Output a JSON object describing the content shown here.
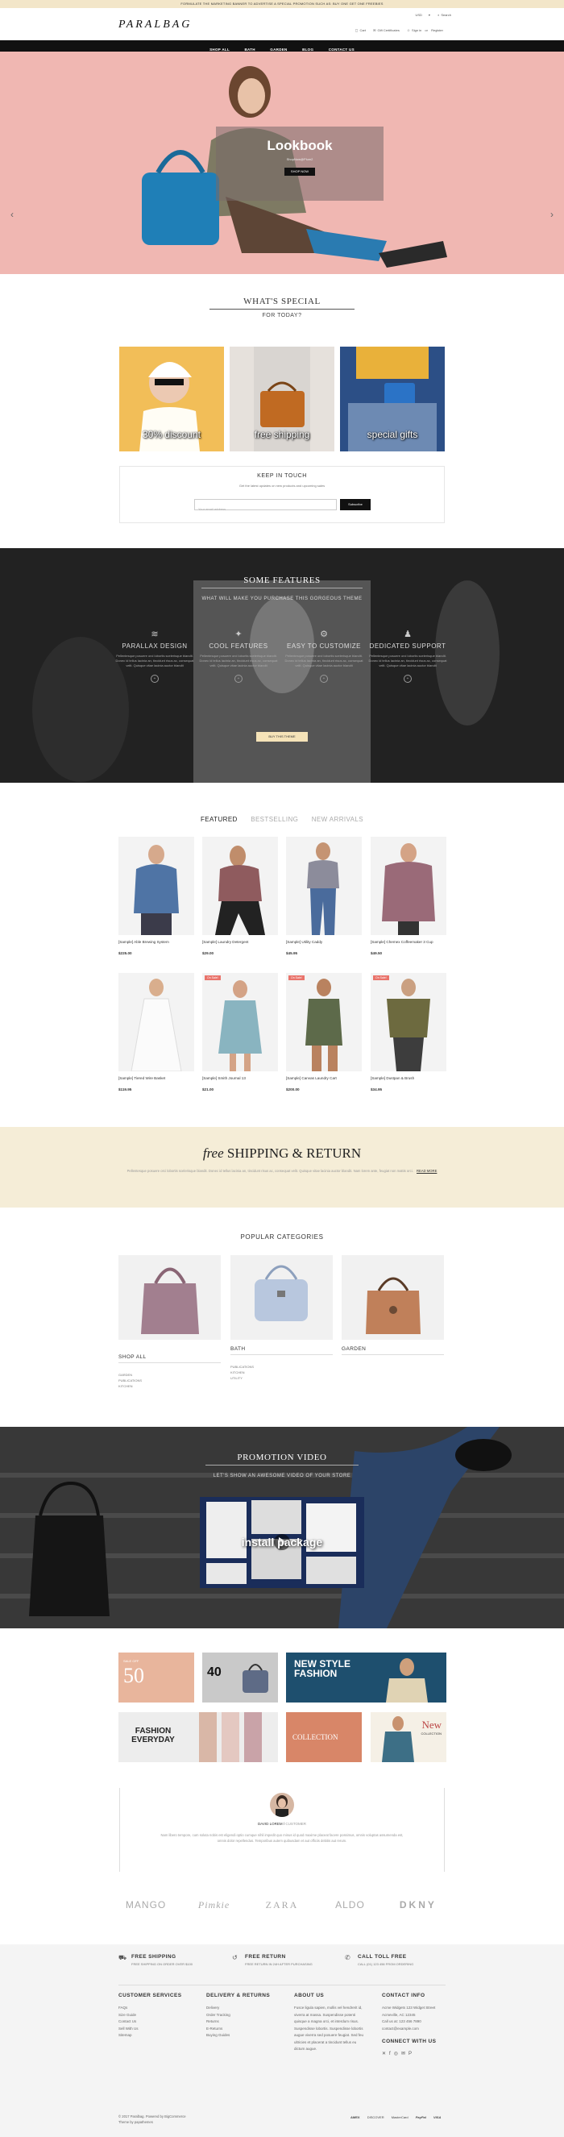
{
  "topbar": {
    "text": "FORMULATE THE MARKETING BANNER TO ADVERTISE A SPECIAL PROMOTION SUCH AS: BUY ONE GET ONE FREEBIES"
  },
  "header": {
    "logo": "PARALBAG",
    "currency": "USD",
    "search": "Search",
    "cart": "Cart",
    "gift": "Gift Certificates",
    "signin": "Sign in",
    "or": "or",
    "register": "Register"
  },
  "nav": {
    "items": [
      "SHOP ALL",
      "BATH",
      "GARDEN",
      "BLOG",
      "CONTACT US"
    ]
  },
  "hero": {
    "title": "Lookbook",
    "subtitle": "ShopNow@Plum2",
    "button": "SHOP NOW"
  },
  "special": {
    "title": "WHAT'S SPECIAL",
    "subtitle": "FOR TODAY?",
    "tiles": [
      "30% discount",
      "free shipping",
      "special gifts"
    ]
  },
  "newsletter": {
    "title": "KEEP IN TOUCH",
    "desc": "Get the latest updates on new products and upcoming sales",
    "placeholder": "Your email address",
    "button": "Subscribe"
  },
  "features": {
    "title": "SOME FEATURES",
    "subtitle": "WHAT WILL MAKE YOU PURCHASE THIS GORGEOUS THEME",
    "button": "BUY THIS THEME",
    "items": [
      {
        "title": "PARALLAX DESIGN",
        "text": "Pellentesque posuere orci lobortis scelerisque blandit. Donec id tellus lacinia an, tincidunt risus ac, consequat velit. Quisque vitae lacinia auctor blandit"
      },
      {
        "title": "COOL FEATURES",
        "text": "Pellentesque posuere orci lobortis scelerisque blandit. Donec id tellus lacinia an, tincidunt risus ac, consequat velit. Quisque vitae lacinia auctor blandit"
      },
      {
        "title": "EASY TO CUSTOMIZE",
        "text": "Pellentesque posuere orci lobortis scelerisque blandit. Donec id tellus lacinia an, tincidunt risus ac, consequat velit. Quisque vitae lacinia auctor blandit"
      },
      {
        "title": "DEDICATED SUPPORT",
        "text": "Pellentesque posuere orci lobortis scelerisque blandit. Donec id tellus lacinia an, tincidunt risus ac, consequat velit. Quisque vitae lacinia auctor blandit"
      }
    ]
  },
  "tabs": [
    "FEATURED",
    "BESTSELLING",
    "NEW ARRIVALS"
  ],
  "products": [
    {
      "name": "[Sample] Able Brewing System",
      "price": "$225.00",
      "badge": ""
    },
    {
      "name": "[Sample] Laundry Detergent",
      "price": "$29.00",
      "badge": ""
    },
    {
      "name": "[Sample] Utility Caddy",
      "price": "$45.95",
      "badge": ""
    },
    {
      "name": "[Sample] Chemex Coffeemaker 3 Cup",
      "price": "$49.50",
      "badge": ""
    },
    {
      "name": "[Sample] Tiered Wire Basket",
      "price": "$119.95",
      "badge": ""
    },
    {
      "name": "[Sample] Smith Journal 13",
      "price": "$21.00",
      "badge": "On Sale!"
    },
    {
      "name": "[Sample] Canvas Laundry Cart",
      "price": "$200.00",
      "badge": "On Sale!"
    },
    {
      "name": "[Sample] Dustpan & Brush",
      "price": "$34.95",
      "badge": "On Sale!"
    }
  ],
  "freeship": {
    "free": "free",
    "title": "SHIPPING & RETURN",
    "text": "Pellentesque posuere orci lobortis scelerisque blandit. Donec id tellus lacinia an, tincidunt risus ac, consequat velit. Quisque vitae lacinia auctor blandit. Nam lorem ante, feugiat non mattis orci.",
    "readmore": "READ MORE"
  },
  "categories": {
    "title": "POPULAR CATEGORIES",
    "items": [
      {
        "name": "SHOP ALL",
        "subs": [
          "GARDEN",
          "PUBLICATIONS",
          "KITCHEN"
        ]
      },
      {
        "name": "BATH",
        "subs": [
          "PUBLICATIONS",
          "KITCHEN",
          "UTILITY"
        ]
      },
      {
        "name": "GARDEN",
        "subs": []
      }
    ]
  },
  "promo": {
    "title": "PROMOTION VIDEO",
    "subtitle": "LET'S SHOW AN AWESOME VIDEO OF YOUR STORE",
    "video_text": "install package"
  },
  "banners": {
    "b1": "50",
    "b1small": "SALE OFF",
    "b2": "40",
    "b3": "NEW STYLE FASHION",
    "b4": "FASHION EVERYDAY",
    "b5": "COLLECTION",
    "b6": "New",
    "b6sub": "COLLECTION"
  },
  "testimonial": {
    "name": "DAVID LOREM",
    "role": "CUSTOMER",
    "text": "Nam libero tempore, cum soluta nobis est eligendi optio cumque nihil impedit quo minus id quod maxime placeat facere possimus, omnis voluptas assumenda est, omnis dolor repellendus. Temporibus autem quibusdam et aut officiis debitis aut rerum."
  },
  "brands": [
    "MANGO",
    "Pimkie",
    "ZARA",
    "ALDO",
    "DKNY"
  ],
  "services": [
    {
      "title": "FREE SHIPPING",
      "text": "FREE SHIPPING ON ORDER OVER $100"
    },
    {
      "title": "FREE RETURN",
      "text": "FREE RETURN IN 24H AFTER PURCHASING"
    },
    {
      "title": "CALL TOLL FREE",
      "text": "CALL (01) 123 456 FROM ORDERING"
    }
  ],
  "footer": {
    "customer": {
      "title": "CUSTOMER SERVICES",
      "links": [
        "FAQs",
        "Size Guide",
        "Contact Us",
        "Sell With Us",
        "Sitemap"
      ]
    },
    "delivery": {
      "title": "DELIVERY & RETURNS",
      "links": [
        "Delivery",
        "Order Tracking",
        "Returns",
        "E-Returns",
        "Buying Guides"
      ]
    },
    "about": {
      "title": "ABOUT US",
      "text": "Fusce ligula sapien, mollis vel hendrerit id, viverra at massa. Suspendisse potenti quisque a magna orci, et interdum risus. Suspendisse lobortis. Suspendisse lobortis augue viverra sed posuere feugiat. Sed feu ultricies et placerat a tincidunt tellus eu dictum augue."
    },
    "contact": {
      "title": "CONTACT INFO",
      "address": "Acme Widgets 123 Widget Street Acmeville, AC 12345",
      "phone": "Call us at: 123 456 7890",
      "email": "contact@example.com",
      "connect": "CONNECT WITH US"
    },
    "copyright": "© 2017 Paralbag. Powered by BigCommerce",
    "theme": "Theme by papathemes",
    "payments": [
      "AMEX",
      "DISCOVER",
      "MasterCard",
      "PayPal",
      "VISA"
    ]
  }
}
